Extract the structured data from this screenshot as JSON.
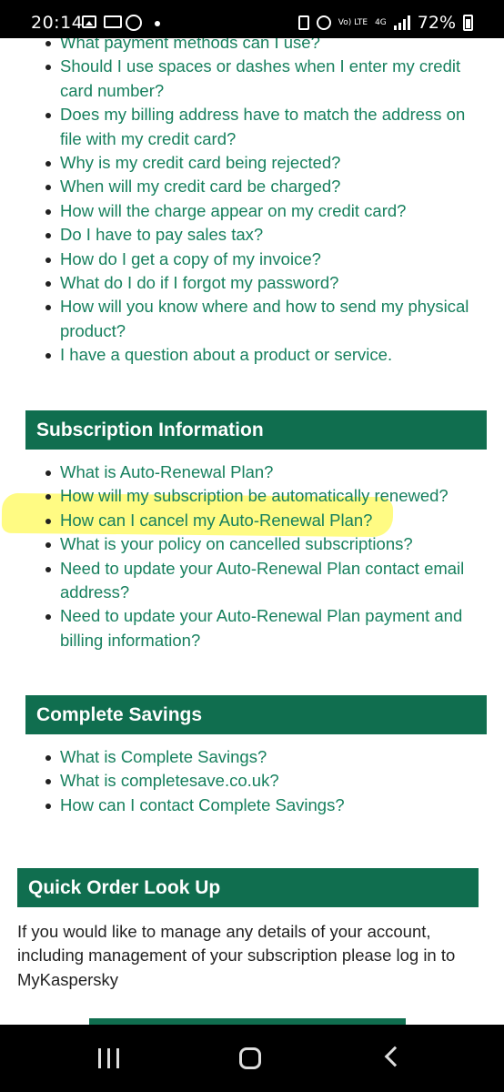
{
  "status_bar": {
    "time": "20:14",
    "battery": "72%",
    "volte": "Vo) LTE",
    "network": "4G",
    "icons": [
      "gallery-icon",
      "message-icon",
      "whatsapp-icon",
      "dot-icon",
      "sim-icon",
      "alarm-icon",
      "volte-icon",
      "network-4g-icon",
      "signal-icon",
      "battery-icon"
    ]
  },
  "payment_questions": [
    "What payment methods can I use?",
    "Should I use spaces or dashes when I enter my credit card number?",
    "Does my billing address have to match the address on file with my credit card?",
    "Why is my credit card being rejected?",
    "When will my credit card be charged?",
    "How will the charge appear on my credit card?",
    "Do I have to pay sales tax?",
    "How do I get a copy of my invoice?",
    "What do I do if I forgot my password?",
    "How will you know where and how to send my physical product?",
    "I have a question about a product or service."
  ],
  "subscription": {
    "title": "Subscription Information",
    "questions": [
      "What is Auto-Renewal Plan?",
      "How will my subscription be automatically renewed?",
      "How can I cancel my Auto-Renewal Plan?",
      "What is your policy on cancelled subscriptions?",
      "Need to update your Auto-Renewal Plan contact email address?",
      "Need to update your Auto-Renewal Plan payment and billing information?"
    ]
  },
  "complete_savings": {
    "title": "Complete Savings",
    "questions": [
      "What is Complete Savings?",
      "What is completesave.co.uk?",
      "How can I contact Complete Savings?"
    ]
  },
  "quick_order": {
    "title": "Quick Order Look Up",
    "text": "If you would like to manage any details of your account, including management of your subscription please log in to MyKaspersky"
  },
  "colors": {
    "link": "#17805e",
    "header_bg": "#106e4f",
    "highlight": "#fffa5a"
  },
  "nav_bar": {
    "icons": [
      "recents-icon",
      "home-icon",
      "back-icon"
    ]
  }
}
